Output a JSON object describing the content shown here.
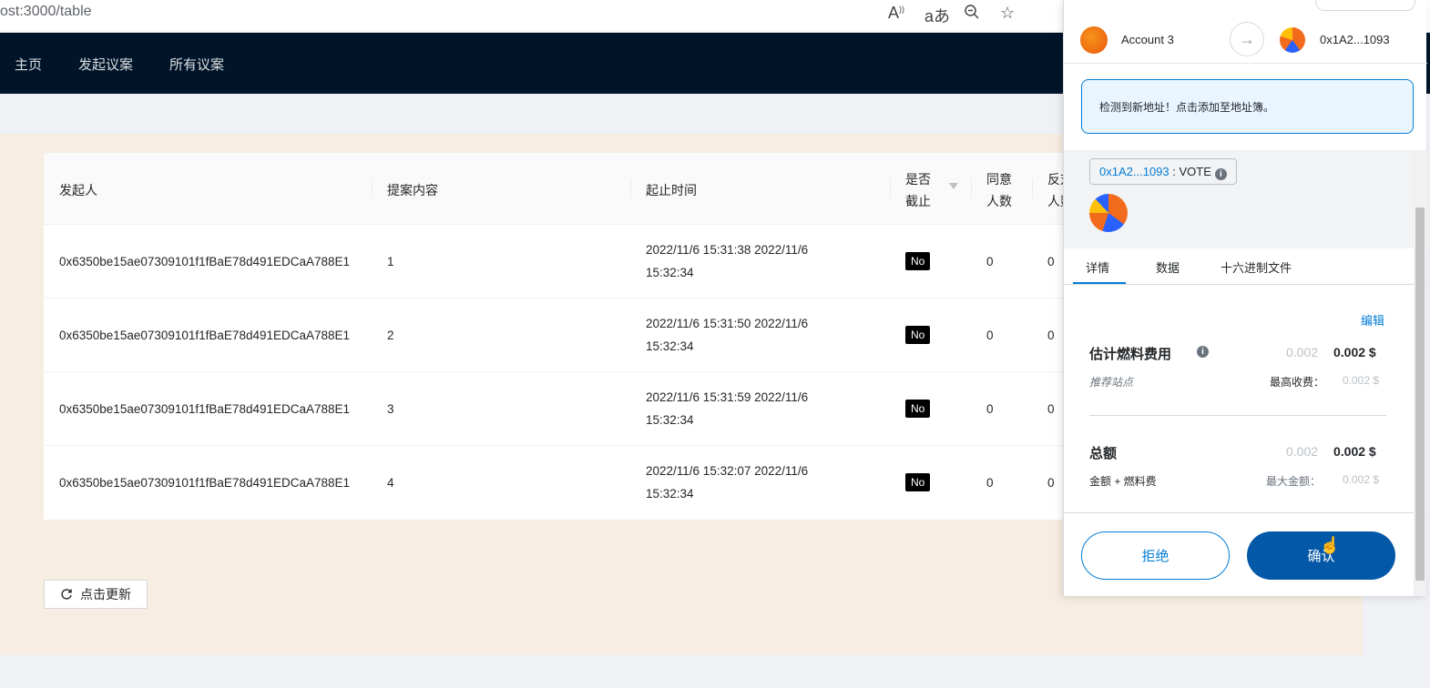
{
  "browser": {
    "url": "ost:3000/table",
    "icons": [
      "read-aloud-icon",
      "translate-icon",
      "zoom-out-icon",
      "favorites-icon"
    ]
  },
  "nav": {
    "items": [
      "主页",
      "发起议案",
      "所有议案"
    ]
  },
  "table": {
    "headers": {
      "initiator": "发起人",
      "content": "提案内容",
      "time": "起止时间",
      "ended_1": "是否",
      "ended_2": "截止",
      "agree_1": "同意",
      "agree_2": "人数",
      "against_1": "反对",
      "against_2": "人数"
    },
    "rows": [
      {
        "initiator": "0x6350be15ae07309101f1fBaE78d491EDCaA788E1",
        "content": "1",
        "time_1": "2022/11/6 15:31:38 2022/11/6",
        "time_2": "15:32:34",
        "ended": "No",
        "agree": "0",
        "against": "0"
      },
      {
        "initiator": "0x6350be15ae07309101f1fBaE78d491EDCaA788E1",
        "content": "2",
        "time_1": "2022/11/6 15:31:50 2022/11/6",
        "time_2": "15:32:34",
        "ended": "No",
        "agree": "0",
        "against": "0"
      },
      {
        "initiator": "0x6350be15ae07309101f1fBaE78d491EDCaA788E1",
        "content": "3",
        "time_1": "2022/11/6 15:31:59 2022/11/6",
        "time_2": "15:32:34",
        "ended": "No",
        "agree": "0",
        "against": "0"
      },
      {
        "initiator": "0x6350be15ae07309101f1fBaE78d491EDCaA788E1",
        "content": "4",
        "time_1": "2022/11/6 15:32:07 2022/11/6",
        "time_2": "15:32:34",
        "ended": "No",
        "agree": "0",
        "against": "0"
      }
    ],
    "refresh_label": "点击更新"
  },
  "metamask": {
    "from_account": "Account 3",
    "to_address": "0x1A2...1093",
    "alert": "检测到新地址！点击添加至地址簿。",
    "method_addr": "0x1A2...1093",
    "method_sep": " : ",
    "method_name": "VOTE",
    "tabs": [
      "详情",
      "数据",
      "十六进制文件"
    ],
    "edit": "编辑",
    "gas": {
      "label": "估计燃料费用",
      "value_gray": "0.002",
      "value_bold": "0.002 $",
      "sub_left": "推荐站点",
      "sub_label": "最高收费：",
      "sub_value": "0.002 $"
    },
    "total": {
      "label": "总额",
      "value_gray": "0.002",
      "value_bold": "0.002 $",
      "sub_left": "金额 + 燃料费",
      "sub_label": "最大金额：",
      "sub_value": "0.002 $"
    },
    "reject": "拒绝",
    "confirm": "确认"
  },
  "colors": {
    "navbar": "#001529",
    "content_bg": "#f7ede2",
    "mm_primary": "#037dd6",
    "mm_confirm": "#0458a8"
  }
}
